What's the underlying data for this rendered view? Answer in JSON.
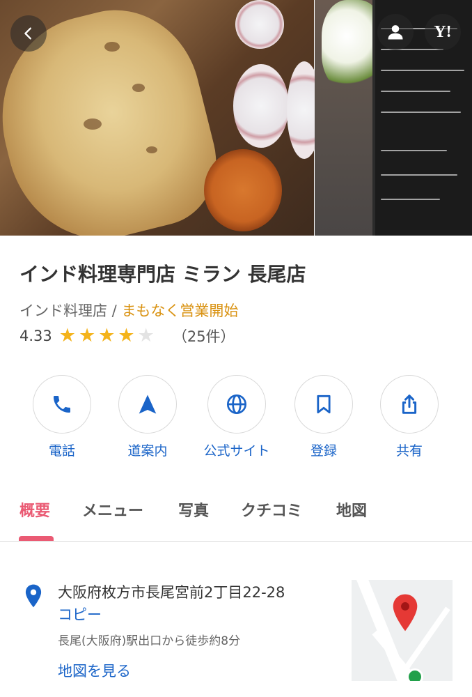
{
  "header": {
    "back_icon": "chevron-left-icon",
    "user_icon": "user-icon",
    "yahoo_logo": "Y!"
  },
  "shop": {
    "name": "インド料理専門店 ミラン 長尾店",
    "category": "インド料理店",
    "separator": " / ",
    "status": "まもなく営業開始",
    "rating": "4.33",
    "stars": 4,
    "review_count": "（25件）"
  },
  "actions": [
    {
      "icon": "phone-icon",
      "label": "電話"
    },
    {
      "icon": "navigation-arrow-icon",
      "label": "道案内"
    },
    {
      "icon": "globe-icon",
      "label": "公式サイト"
    },
    {
      "icon": "bookmark-icon",
      "label": "登録"
    },
    {
      "icon": "share-icon",
      "label": "共有"
    }
  ],
  "tabs": [
    {
      "label": "概要",
      "active": true
    },
    {
      "label": "メニュー",
      "active": false
    },
    {
      "label": "写真",
      "active": false
    },
    {
      "label": "クチコミ",
      "active": false
    },
    {
      "label": "地図",
      "active": false
    }
  ],
  "address": {
    "text": "大阪府枚方市長尾宮前2丁目22-28",
    "copy_label": "コピー",
    "access": "長尾(大阪府)駅出口から徒歩約8分",
    "map_link": "地図を見る"
  },
  "colors": {
    "accent_blue": "#1a64c8",
    "tab_active": "#ea5a73",
    "star": "#f4b31b",
    "status_orange": "#d99211",
    "map_pin": "#e53935"
  }
}
